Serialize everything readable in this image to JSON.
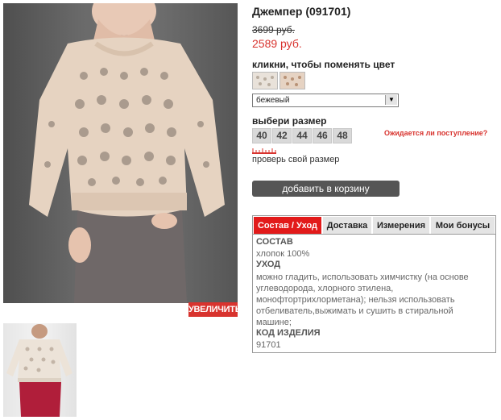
{
  "product": {
    "title": "Джемпер (091701)",
    "old_price": "3699 руб.",
    "new_price": "2589 руб."
  },
  "gallery": {
    "zoom_label": "УВЕЛИЧИТЬ"
  },
  "color": {
    "label": "кликни, чтобы поменять цвет",
    "selected": "бежевый",
    "swatches": [
      "#e9e2da",
      "#e6d3c3"
    ]
  },
  "size": {
    "label": "выбери размер",
    "options": [
      "40",
      "42",
      "44",
      "46",
      "48"
    ],
    "notify_label": "Ожидается ли поступление?",
    "check_label": "проверь свой размер"
  },
  "cart": {
    "add_label": "добавить в корзину"
  },
  "tabs": {
    "items": [
      "Состав / Уход",
      "Доставка",
      "Измерения",
      "Мои бонусы"
    ],
    "active": "Состав / Уход"
  },
  "details": {
    "composition_heading": "СОСТАВ",
    "composition": "хлопок 100%",
    "care_heading": "УХОД",
    "care": "можно гладить, использовать химчистку (на основе углеводорода, хлорного этилена, монофтортрихлорметана); нельзя использовать отбеливатель,выжимать и сушить в стиральной машине;",
    "code_heading": "КОД ИЗДЕЛИЯ",
    "code": "91701"
  },
  "colors": {
    "accent_red": "#d8332e",
    "tab_active": "#e21a1a",
    "button_dark": "#555555"
  }
}
